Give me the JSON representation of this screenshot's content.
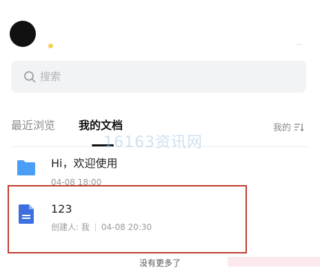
{
  "search": {
    "placeholder": "搜索",
    "icon": "search-icon"
  },
  "tabs": [
    {
      "label": "最近浏览",
      "active": false
    },
    {
      "label": "我的文档",
      "active": true
    }
  ],
  "sort": {
    "label": "我的",
    "icon": "sort-list-icon"
  },
  "watermark": "16163资讯网",
  "files": [
    {
      "title": "Hi，欢迎使用",
      "meta": "04-08 18:00",
      "icon": "folder-icon",
      "color": "#4a9ef6"
    },
    {
      "title": "123",
      "creator": "创建人: 我",
      "meta": "04-08 20:30",
      "icon": "doc-icon",
      "color": "#3d6fe0"
    }
  ],
  "footer": "没有更多了",
  "colors": {
    "highlight": "#c0392b",
    "folder": "#4a9ef6",
    "doc": "#3d6fe0"
  }
}
